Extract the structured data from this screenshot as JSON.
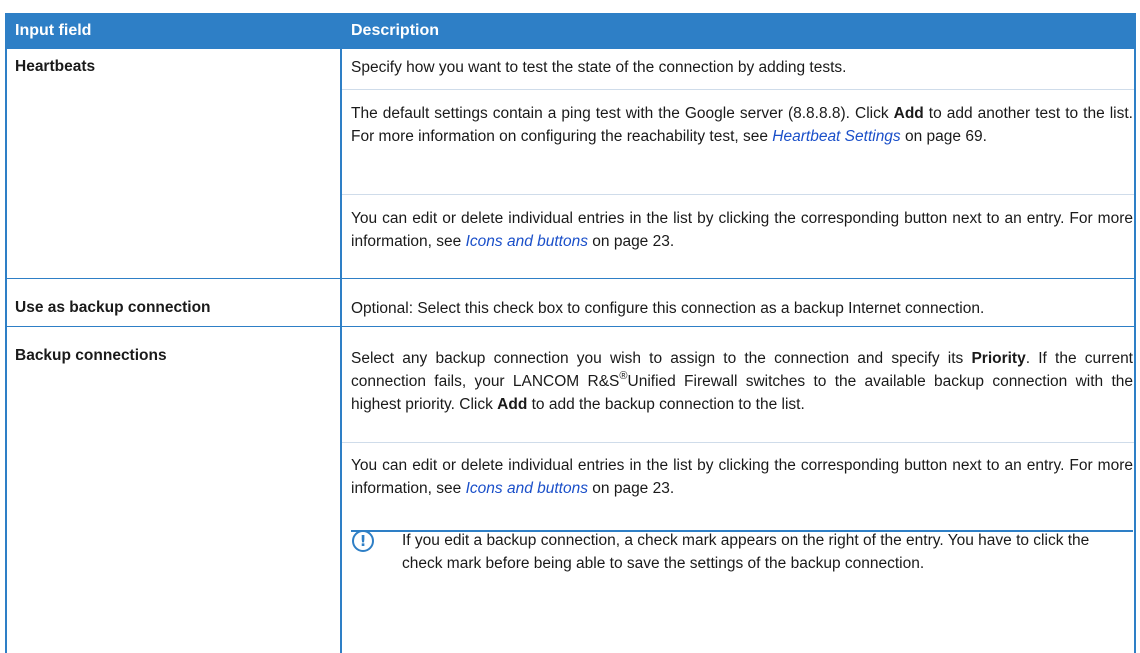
{
  "header": {
    "col1": "Input field",
    "col2": "Description"
  },
  "rows": {
    "heartbeats": {
      "label": "Heartbeats",
      "p1": "Specify how you want to test the state of the connection by adding tests.",
      "p2_a": "The default settings contain a ping test with the Google server (8.8.8.8). Click ",
      "p2_bold": "Add",
      "p2_b": " to add another test to the list. For more information on configuring the reachability test, see ",
      "p2_link": "Heartbeat Settings",
      "p2_c": " on page 69.",
      "p3_a": "You can edit or delete individual entries in the list by clicking the corresponding button next to an entry. For more information, see ",
      "p3_link": "Icons and buttons",
      "p3_b": " on page 23."
    },
    "backup_use": {
      "label": "Use as backup connection",
      "p1": "Optional: Select this check box to configure this connection as a backup Internet connection."
    },
    "backup_connections": {
      "label": "Backup connections",
      "p1_a": "Select any backup connection you wish to assign to the connection and specify its ",
      "p1_bold": "Priority",
      "p1_b": ". If the current connection fails, your LANCOM R&S",
      "p1_reg": "®",
      "p1_c": "Unified Firewall switches to the available backup connection with the highest priority. Click ",
      "p1_bold2": "Add",
      "p1_d": " to add the backup connection to the list.",
      "p2_a": "You can edit or delete individual entries in the list by clicking the corresponding button next to an entry. For more information, see ",
      "p2_link": "Icons and buttons",
      "p2_b": " on page 23.",
      "note_icon": "!",
      "note": "If you edit a backup connection, a check mark appears on the right of the entry. You have to click the check mark before being able to save the settings of the backup connection."
    }
  },
  "colors": {
    "accent": "#2e7fc6",
    "link": "#1a4fc9"
  }
}
